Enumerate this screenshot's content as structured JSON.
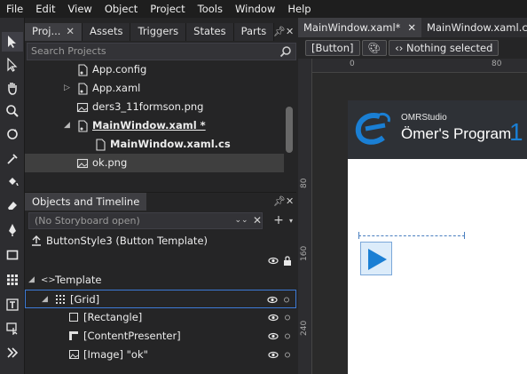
{
  "menu": [
    "File",
    "Edit",
    "View",
    "Object",
    "Project",
    "Tools",
    "Window",
    "Help"
  ],
  "projects_panel": {
    "tabs": [
      {
        "label": "Proj...",
        "active": true,
        "closable": true
      },
      {
        "label": "Assets"
      },
      {
        "label": "Triggers"
      },
      {
        "label": "States"
      },
      {
        "label": "Parts"
      }
    ],
    "search_placeholder": "Search Projects",
    "tree": [
      {
        "label": "App.config",
        "icon": "config-file-icon",
        "style": "normal"
      },
      {
        "label": "App.xaml",
        "icon": "xaml-file-icon",
        "style": "normal",
        "expander": "collapsed"
      },
      {
        "label": "ders3_11formson.png",
        "icon": "image-file-icon",
        "style": "normal"
      },
      {
        "label": "MainWindow.xaml *",
        "icon": "xaml-file-icon",
        "style": "bold-underline",
        "expander": "expanded"
      },
      {
        "label": "MainWindow.xaml.cs",
        "icon": "cs-file-icon",
        "style": "bold"
      },
      {
        "label": "ok.png",
        "icon": "image-file-icon",
        "style": "normal",
        "selected": true
      }
    ]
  },
  "objects_panel": {
    "title": "Objects and Timeline",
    "storyboard": "(No Storyboard open)",
    "scope": "ButtonStyle3 (Button Template)",
    "tree": [
      {
        "label": "Template",
        "icon": "template-icon"
      },
      {
        "label": "[Grid]",
        "icon": "grid-icon",
        "selected": true
      },
      {
        "label": "[Rectangle]",
        "icon": "rectangle-icon"
      },
      {
        "label": "[ContentPresenter]",
        "icon": "content-presenter-icon"
      },
      {
        "label": "[Image] \"ok\"",
        "icon": "image-element-icon"
      }
    ]
  },
  "doc_tabs": [
    {
      "label": "MainWindow.xaml*",
      "active": true,
      "closable": true
    },
    {
      "label": "MainWindow.xaml.cs"
    }
  ],
  "breadcrumb": {
    "element": "[Button]",
    "selection": "Nothing selected"
  },
  "rulers": {
    "top": [
      "0",
      "80"
    ],
    "left": [
      "80",
      "160",
      "240"
    ]
  },
  "artboard": {
    "brand": "OMRStudio",
    "title": "Ömer's Program",
    "title_suffix": "1"
  },
  "colors": {
    "accent": "#1a7fd4",
    "selection": "#3d7ad6"
  }
}
